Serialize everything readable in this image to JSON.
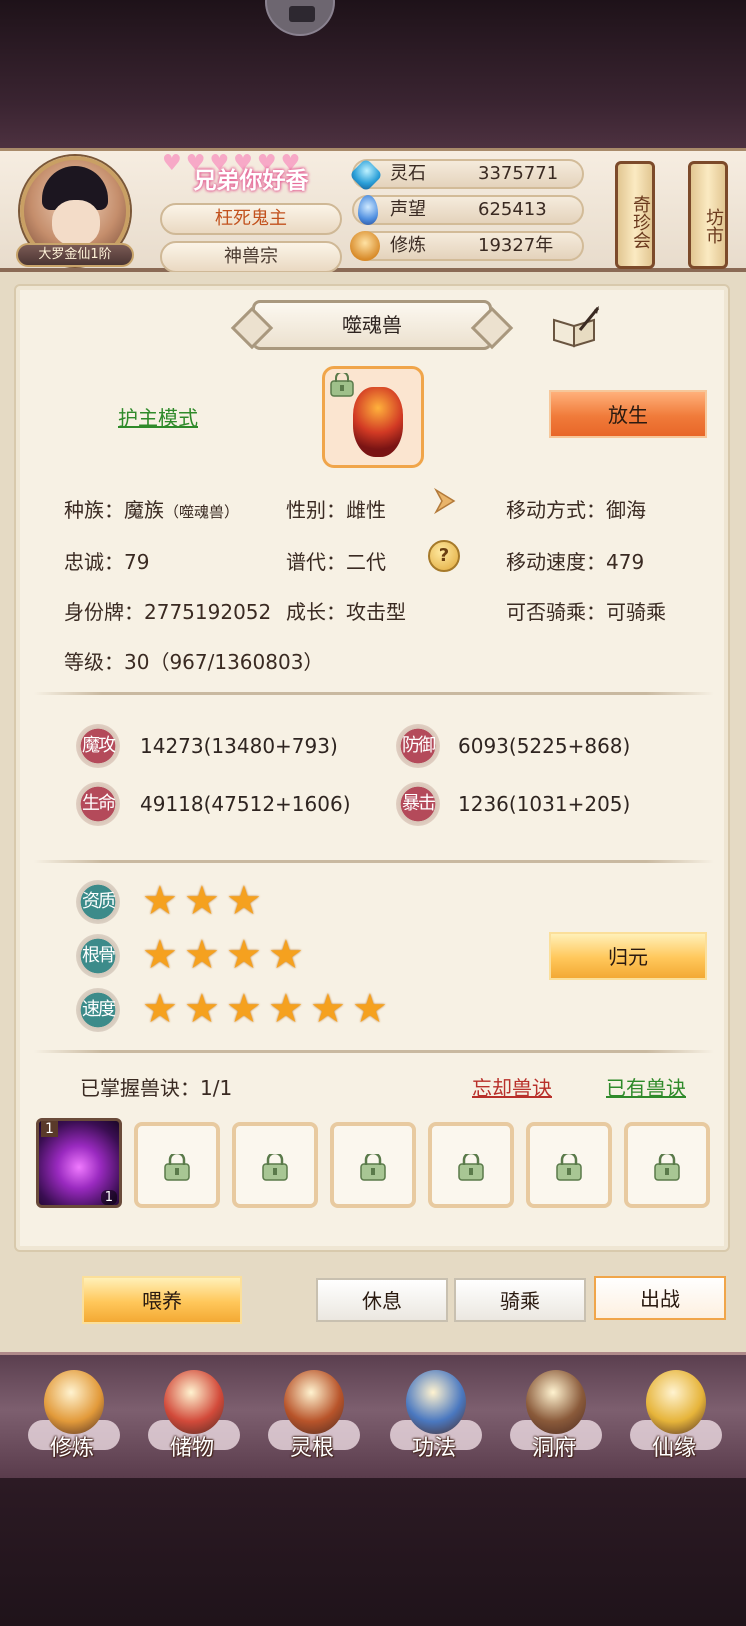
{
  "header": {
    "nickname": "兄弟你好香",
    "title": "枉死鬼主",
    "sect": "神兽宗",
    "rank": "大罗金仙1阶",
    "stats": [
      {
        "icon": "spirit-stone-icon",
        "label": "灵石",
        "value": "3375771"
      },
      {
        "icon": "reputation-icon",
        "label": "声望",
        "value": "625413"
      },
      {
        "icon": "cultivation-icon",
        "label": "修炼",
        "value": "19327年"
      }
    ],
    "side_buttons": [
      "奇珍会",
      "坊市"
    ]
  },
  "pet": {
    "name": "噬魂兽",
    "mode_link": "护主模式",
    "release_button": "放生",
    "info": {
      "race_label": "种族：",
      "race_value": "魔族",
      "race_sub": "（噬魂兽）",
      "gender": "性别：雌性",
      "move_type": "移动方式：御海",
      "loyalty": "忠诚：79",
      "generation": "谱代：二代",
      "move_speed": "移动速度：479",
      "id_tag": "身份牌：2775192052",
      "growth": "成长：攻击型",
      "rideable": "可否骑乘：可骑乘",
      "level": "等级：30（967/1360803）"
    },
    "attributes": [
      {
        "badge": "魔攻",
        "value": "14273(13480+793)"
      },
      {
        "badge": "防御",
        "value": "6093(5225+868)"
      },
      {
        "badge": "生命",
        "value": "49118(47512+1606)"
      },
      {
        "badge": "暴击",
        "value": "1236(1031+205)"
      }
    ],
    "ratings": [
      {
        "badge": "资质",
        "stars": 3
      },
      {
        "badge": "根骨",
        "stars": 4
      },
      {
        "badge": "速度",
        "stars": 6
      }
    ],
    "reset_button": "归元",
    "skills": {
      "mastered": "已掌握兽诀：1/1",
      "forget_link": "忘却兽诀",
      "owned_link": "已有兽诀",
      "active_slot_level": "1",
      "active_slot_count": "1",
      "locked_slots": 6
    }
  },
  "actions": {
    "feed": "喂养",
    "rest": "休息",
    "ride": "骑乘",
    "battle": "出战"
  },
  "nav": [
    {
      "label": "修炼",
      "icon": "cultivate-icon",
      "color": "#e29a3a"
    },
    {
      "label": "储物",
      "icon": "storage-bag-icon",
      "color": "#d24a3a"
    },
    {
      "label": "灵根",
      "icon": "spirit-root-icon",
      "color": "#b8542a"
    },
    {
      "label": "功法",
      "icon": "scripture-book-icon",
      "color": "#4a78c0"
    },
    {
      "label": "洞府",
      "icon": "cave-mansion-icon",
      "color": "#8a5a3a"
    },
    {
      "label": "仙缘",
      "icon": "fate-gourd-icon",
      "color": "#e6b43a"
    }
  ]
}
